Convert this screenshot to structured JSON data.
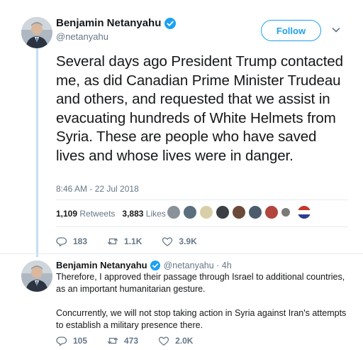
{
  "main_tweet": {
    "display_name": "Benjamin Netanyahu",
    "handle": "@netanyahu",
    "follow_label": "Follow",
    "text": "Several days ago President Trump contacted me, as did Canadian Prime Minister Trudeau and others, and requested that we assist in evacuating hundreds of White Helmets from Syria. These are people who have saved lives and whose lives were in danger.",
    "timestamp": "8:46 AM - 22 Jul 2018",
    "retweets_count": "1,109",
    "retweets_label": "Retweets",
    "likes_count": "3,883",
    "likes_label": "Likes",
    "actions": {
      "replies": "183",
      "retweets": "1.1K",
      "likes": "3.9K"
    }
  },
  "reply_tweet": {
    "display_name": "Benjamin Netanyahu",
    "handle_time": "@netanyahu · 4h",
    "paragraph_1": "Therefore, I approved their passage through Israel to additional countries, as an important humanitarian gesture.",
    "paragraph_2": "Concurrently, we will not stop taking action in Syria against Iran's attempts to establish a military presence there.",
    "actions": {
      "replies": "105",
      "retweets": "473",
      "likes": "2.0K"
    }
  },
  "colors": {
    "accent": "#1da1f2",
    "text_primary": "#14171a",
    "text_secondary": "#657786",
    "thread_line": "#c5dfef"
  }
}
